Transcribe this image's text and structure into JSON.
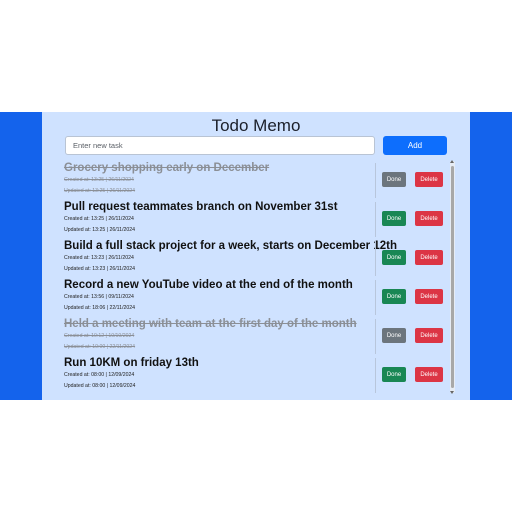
{
  "app": {
    "title": "Todo Memo"
  },
  "new_task": {
    "placeholder": "Enter new task",
    "add_label": "Add"
  },
  "colors": {
    "frame": "#1463ec",
    "panel": "#cfe2ff",
    "done_button": "#198754",
    "done_button_completed": "#6c757d",
    "delete_button": "#dc3545",
    "add_button": "#0d6efd"
  },
  "tasks": [
    {
      "title": "Grocery shopping early on December",
      "created": "Created at: 13:25 | 26/11/2024",
      "updated": "Updated at: 13:25 | 26/11/2024",
      "completed": true,
      "done_label": "Done",
      "delete_label": "Delete"
    },
    {
      "title": "Pull request teammates branch on November 31st",
      "created": "Created at: 13:25 | 26/11/2024",
      "updated": "Updated at: 13:25 | 26/11/2024",
      "completed": false,
      "done_label": "Done",
      "delete_label": "Delete"
    },
    {
      "title": "Build a full stack project for a week, starts on December 12th",
      "created": "Created at: 13:23 | 26/11/2024",
      "updated": "Updated at: 13:23 | 26/11/2024",
      "completed": false,
      "done_label": "Done",
      "delete_label": "Delete"
    },
    {
      "title": "Record a new YouTube video at the end of the month",
      "created": "Created at: 13:56 | 09/11/2024",
      "updated": "Updated at: 18:06 | 22/11/2024",
      "completed": false,
      "done_label": "Done",
      "delete_label": "Delete"
    },
    {
      "title": "Held a meeting with team at the first day of the month",
      "created": "Created at: 10:12 | 10/10/2024",
      "updated": "Updated at: 10:00 | 22/11/2024",
      "completed": true,
      "done_label": "Done",
      "delete_label": "Delete"
    },
    {
      "title": "Run 10KM on friday 13th",
      "created": "Created at: 08:00 | 12/09/2024",
      "updated": "Updated at: 08:00 | 12/09/2024",
      "completed": false,
      "done_label": "Done",
      "delete_label": "Delete"
    }
  ]
}
